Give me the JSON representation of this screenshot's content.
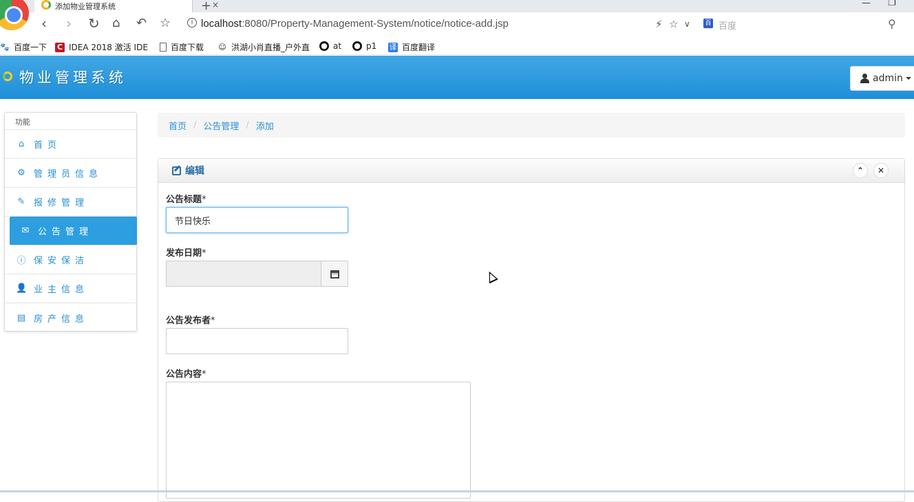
{
  "browser": {
    "tab_title": "添加物业管理系统",
    "tab_close": "×",
    "new_tab": "+",
    "url_host": "localhost",
    "url_rest": ":8080/Property-Management-System/notice/notice-add.jsp",
    "search_placeholder": "百度",
    "bookmarks": [
      {
        "label": "百度一下",
        "icon": "paw-icon"
      },
      {
        "label": "IDEA 2018 激活 IDE",
        "icon": "c-icon"
      },
      {
        "label": "百度下载",
        "icon": "doc-icon"
      },
      {
        "label": "洪湖小肖直播_户外直",
        "icon": "avatar-icon"
      },
      {
        "label": "at",
        "icon": "github-icon"
      },
      {
        "label": "p1",
        "icon": "github-icon"
      },
      {
        "label": "百度翻译",
        "icon": "translate-icon"
      }
    ]
  },
  "header": {
    "title": "物业管理系统",
    "user_label": "admin"
  },
  "sidebar": {
    "heading": "功能",
    "items": [
      {
        "label": "首页",
        "icon": "home-icon"
      },
      {
        "label": "管理员信息",
        "icon": "gear-icon"
      },
      {
        "label": "报修管理",
        "icon": "wrench-icon"
      },
      {
        "label": "公告管理",
        "icon": "envelope-icon"
      },
      {
        "label": "保安保洁",
        "icon": "info-icon"
      },
      {
        "label": "业主信息",
        "icon": "user-icon"
      },
      {
        "label": "房产信息",
        "icon": "list-icon"
      }
    ],
    "active_index": 3
  },
  "breadcrumb": [
    "首页",
    "公告管理",
    "添加"
  ],
  "breadcrumb_separator": "/",
  "panel": {
    "title": "编辑",
    "collapse_icon": "chevron-up-icon",
    "close_icon": "close-icon"
  },
  "form": {
    "title_label": "公告标题",
    "title_value": "节日快乐",
    "date_label": "发布日期",
    "date_value": "",
    "publisher_label": "公告发布者",
    "publisher_value": "",
    "content_label": "公告内容",
    "content_value": "",
    "required_mark": "*"
  },
  "colors": {
    "header_bg": "#2a98dc",
    "accent": "#2a8fd4",
    "active_item": "#2d9ee0"
  }
}
